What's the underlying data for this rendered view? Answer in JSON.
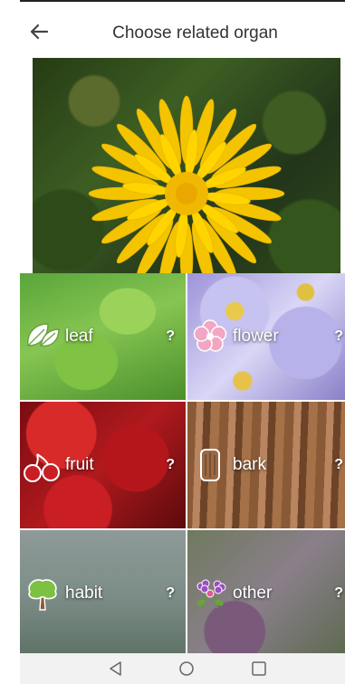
{
  "header": {
    "title": "Choose related organ"
  },
  "icons": {
    "back": "arrow-left-icon",
    "nav_back": "triangle-back-icon",
    "nav_home": "circle-home-icon",
    "nav_recents": "square-recents-icon"
  },
  "organs": [
    {
      "label": "leaf",
      "help": "?",
      "icon": "leaf-icon"
    },
    {
      "label": "flower",
      "help": "?",
      "icon": "flower-icon"
    },
    {
      "label": "fruit",
      "help": "?",
      "icon": "fruit-icon"
    },
    {
      "label": "bark",
      "help": "?",
      "icon": "bark-icon"
    },
    {
      "label": "habit",
      "help": "?",
      "icon": "tree-icon"
    },
    {
      "label": "other",
      "help": "?",
      "icon": "flowers-icon"
    }
  ]
}
